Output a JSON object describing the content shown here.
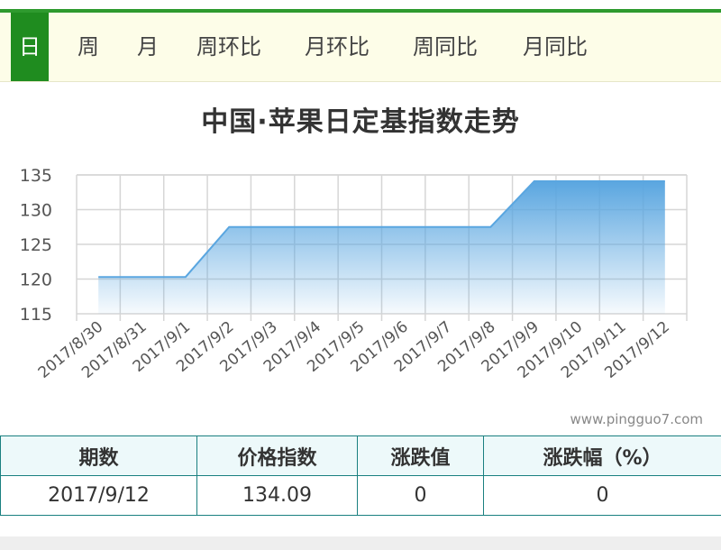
{
  "tabs": [
    {
      "label": "日",
      "active": true
    },
    {
      "label": "周",
      "active": false
    },
    {
      "label": "月",
      "active": false
    },
    {
      "label": "周环比",
      "active": false
    },
    {
      "label": "月环比",
      "active": false
    },
    {
      "label": "周同比",
      "active": false
    },
    {
      "label": "月同比",
      "active": false
    }
  ],
  "watermark": "www.pingguo7.com",
  "colors": {
    "accent": "#1f8c1f",
    "area_top": "#5aa6e0",
    "table_border": "#1a8080",
    "table_header_bg": "#edf9fa"
  },
  "chart_data": {
    "type": "area",
    "title": "中国·苹果日定基指数走势",
    "x": [
      "2017/8/30",
      "2017/8/31",
      "2017/9/1",
      "2017/9/2",
      "2017/9/3",
      "2017/9/4",
      "2017/9/5",
      "2017/9/6",
      "2017/9/7",
      "2017/9/8",
      "2017/9/9",
      "2017/9/10",
      "2017/9/11",
      "2017/9/12"
    ],
    "values": [
      120.3,
      120.3,
      120.3,
      127.5,
      127.5,
      127.5,
      127.5,
      127.5,
      127.5,
      127.5,
      134.09,
      134.09,
      134.09,
      134.09
    ],
    "yticks": [
      115,
      120,
      125,
      130,
      135
    ],
    "ylim": [
      115,
      135
    ],
    "grid": true,
    "xlabel": "",
    "ylabel": ""
  },
  "table": {
    "headers": [
      "期数",
      "价格指数",
      "涨跌值",
      "涨跌幅（%）"
    ],
    "rows": [
      [
        "2017/9/12",
        "134.09",
        "0",
        "0"
      ]
    ]
  }
}
